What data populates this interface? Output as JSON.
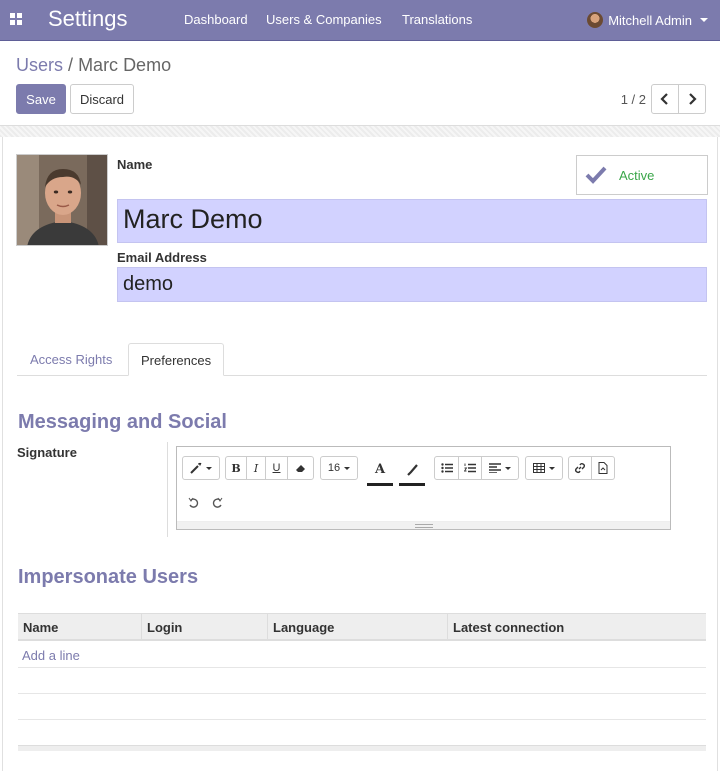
{
  "navbar": {
    "app_title": "Settings",
    "menu": [
      "Dashboard",
      "Users & Companies",
      "Translations"
    ],
    "user_name": "Mitchell Admin",
    "bg_color": "#7c7bad"
  },
  "breadcrumb": {
    "parent": "Users",
    "separator": "/",
    "current": "Marc Demo"
  },
  "actions": {
    "save_label": "Save",
    "discard_label": "Discard"
  },
  "pager": {
    "value": "1 / 2"
  },
  "form": {
    "active_label": "Active",
    "name_label": "Name",
    "name_value": "Marc Demo",
    "email_label": "Email Address",
    "email_value": "demo"
  },
  "tabs": [
    {
      "label": "Access Rights",
      "active": false
    },
    {
      "label": "Preferences",
      "active": true
    }
  ],
  "messaging": {
    "title": "Messaging and Social",
    "signature_label": "Signature",
    "font_size": "16",
    "icons": [
      "magic-wand-icon",
      "bold-icon",
      "italic-icon",
      "underline-icon",
      "eraser-icon",
      "font-color-icon",
      "highlight-icon",
      "bullet-list-icon",
      "numbered-list-icon",
      "align-icon",
      "table-icon",
      "link-icon",
      "file-icon",
      "undo-icon",
      "redo-icon"
    ]
  },
  "impersonate": {
    "title": "Impersonate Users",
    "columns": [
      "Name",
      "Login",
      "Language",
      "Latest connection"
    ],
    "add_line": "Add a line"
  },
  "colors": {
    "accent": "#7c7bad",
    "input_bg": "#d2d2ff",
    "active_green": "#3aa649"
  }
}
